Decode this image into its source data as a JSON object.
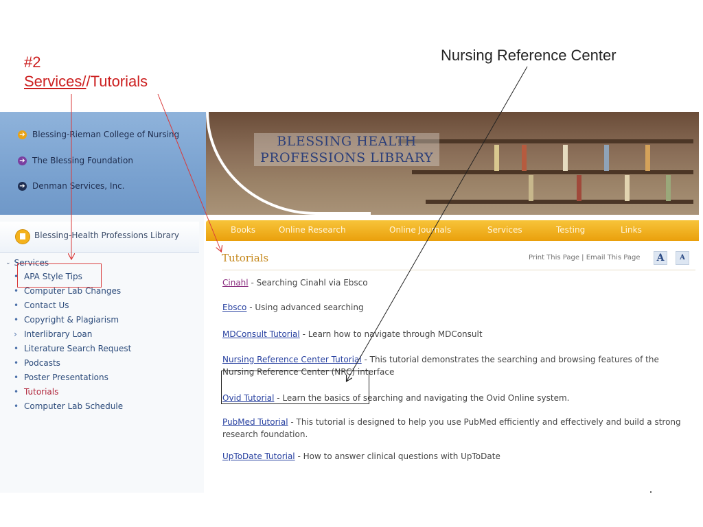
{
  "annotations": {
    "red_line1": "#2",
    "red_services": "Services/",
    "red_tail": "/Tutorials",
    "black_label": "Nursing Reference Center"
  },
  "sidebar": {
    "partner_links": [
      {
        "label": "Blessing-Rieman College of Nursing",
        "icon": "arrow-right-icon",
        "color": "#e8a317"
      },
      {
        "label": "The Blessing Foundation",
        "icon": "arrow-right-icon",
        "color": "#7a3fa0"
      },
      {
        "label": "Denman Services, Inc.",
        "icon": "arrow-right-icon",
        "color": "#1f2f52"
      }
    ],
    "library_link": "Blessing-Health Professions Library",
    "services_heading": "Services",
    "menu": [
      {
        "label": "APA Style Tips",
        "bullet": "•",
        "active": false
      },
      {
        "label": "Computer Lab Changes",
        "bullet": "•",
        "active": false
      },
      {
        "label": "Contact Us",
        "bullet": "•",
        "active": false
      },
      {
        "label": "Copyright & Plagiarism",
        "bullet": "•",
        "active": false
      },
      {
        "label": "Interlibrary Loan",
        "bullet": "›",
        "active": false
      },
      {
        "label": "Literature Search Request",
        "bullet": "•",
        "active": false
      },
      {
        "label": "Podcasts",
        "bullet": "•",
        "active": false
      },
      {
        "label": "Poster Presentations",
        "bullet": "•",
        "active": false
      },
      {
        "label": "Tutorials",
        "bullet": "•",
        "active": true
      },
      {
        "label": "Computer Lab Schedule",
        "bullet": "•",
        "active": false
      }
    ]
  },
  "banner": {
    "title_line1": "BLESSING HEALTH",
    "title_line2": "PROFESSIONS LIBRARY"
  },
  "nav": [
    "Books",
    "Online Research",
    "Online Journals",
    "Services",
    "Testing",
    "Links"
  ],
  "content": {
    "title": "Tutorials",
    "print_links": "Print This Page | Email This Page",
    "font_large": "A",
    "font_small": "A",
    "tutorials": [
      {
        "link": "Cinahl",
        "desc": " - Searching Cinahl via Ebsco",
        "visited": true
      },
      {
        "link": "Ebsco",
        "desc": " - Using advanced searching",
        "visited": false
      },
      {
        "link": "MDConsult Tutorial",
        "desc": " - Learn how to navigate through MDConsult",
        "visited": false
      },
      {
        "link": "Nursing Reference Center Tutorial",
        "desc": " - This tutorial demonstrates the searching and browsing features of the Nursing Reference Center (NRC) interface",
        "visited": false
      },
      {
        "link": "Ovid Tutorial",
        "desc": " - Learn the basics of searching and navigating the Ovid Online system.",
        "visited": false
      },
      {
        "link": "PubMed Tutorial",
        "desc": " - This tutorial is designed to help you use PubMed efficiently and effectively and build a strong research foundation.",
        "visited": false
      },
      {
        "link": "UpToDate Tutorial",
        "desc": " - How to answer clinical questions with UpToDate",
        "visited": false
      }
    ]
  }
}
